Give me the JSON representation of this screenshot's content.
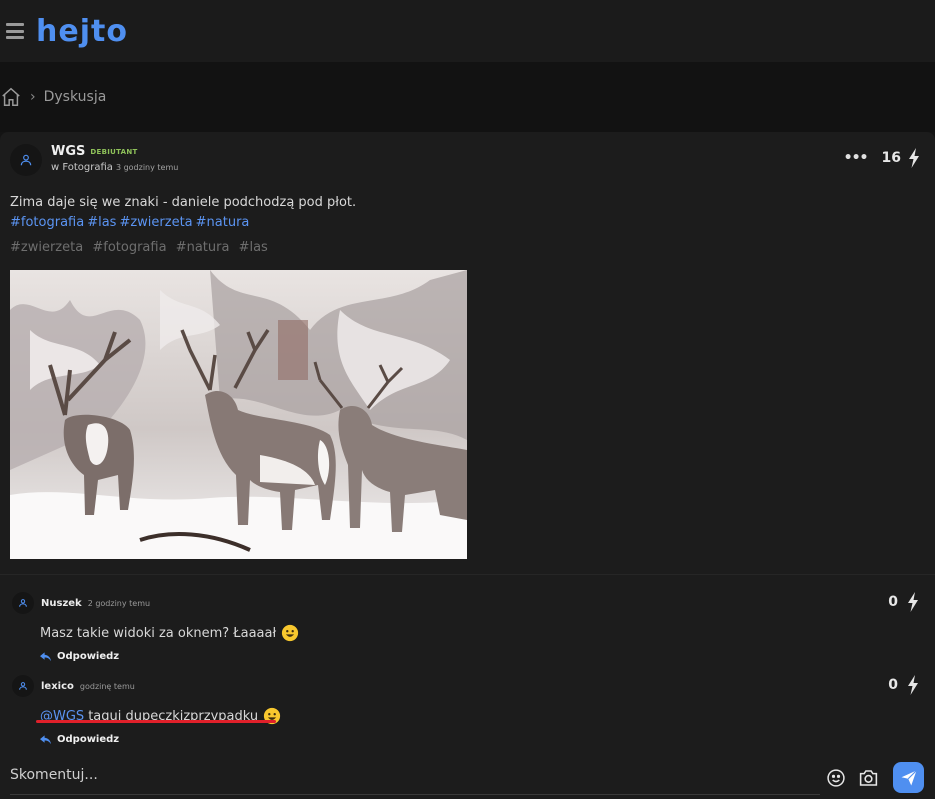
{
  "header": {
    "logo_text": "hejto",
    "accent": "#4f8ff0"
  },
  "breadcrumb": {
    "home_icon": "home-icon",
    "current": "Dyskusja"
  },
  "post": {
    "author": "WGS",
    "badge": "DEBIUTANT",
    "community": "w Fotografia",
    "time": "3 godziny temu",
    "votes": "16",
    "text": "Zima daje się we znaki - daniele podchodzą pod płot.",
    "inline_hashtags": [
      "#fotografia",
      "#las",
      "#zwierzeta",
      "#natura"
    ],
    "tags": [
      "#zwierzeta",
      "#fotografia",
      "#natura",
      "#las"
    ]
  },
  "comments": [
    {
      "author": "Nuszek",
      "time": "2 godziny temu",
      "text": "Masz takie widoki za oknem? Łaaaał",
      "mention": "",
      "votes": "0",
      "reply_label": "Odpowiedz"
    },
    {
      "author": "lexico",
      "time": "godzinę temu",
      "mention": "@WGS",
      "text": "taguj dupeczkizprzypadku",
      "votes": "0",
      "reply_label": "Odpowiedz"
    }
  ],
  "comment_input": {
    "placeholder": "Skomentuj..."
  },
  "colors": {
    "annotation_underline": "#e0202a",
    "link": "#5b94f2",
    "badge": "#8fc25a"
  }
}
